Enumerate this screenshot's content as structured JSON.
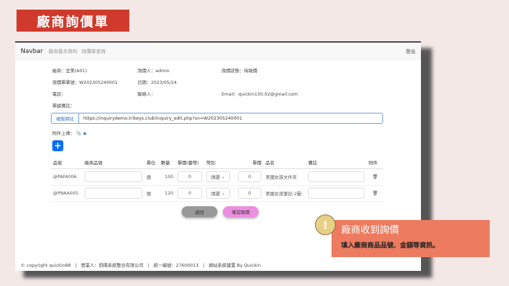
{
  "banner": "廠商詢價單",
  "nav": {
    "brand": "Navbar",
    "links": [
      "廠商基本資料",
      "詢價單查詢"
    ],
    "logout": "登出"
  },
  "info": {
    "vendor": "廠商：呈美(A01)",
    "inquirer": "詢價人：admin",
    "status": "詢價狀態：待報價",
    "number": "詢價單單號：W202305240001",
    "date": "日期：2023/05/24",
    "phone": "電話：",
    "contact": "聯絡人：",
    "email": "Email：quickin130.02@gmail.com",
    "note": "單據備註：",
    "copy_btn": "複製網址",
    "url": "https://inquirydemo.trikeys.club/inquiry_edit.php?sn=W202305240001",
    "attach": "附件上傳："
  },
  "table": {
    "headers": [
      "品號",
      "廠商品號",
      "單位",
      "數量",
      "單價(臺幣)",
      "幣別",
      "單價",
      "品名",
      "備註",
      "附件"
    ],
    "rows": [
      {
        "code": "@PAFA006",
        "unit": "個",
        "qty": "100",
        "twd": "0",
        "currency": "請選",
        "price": "0",
        "name": "美國女孩文件夾"
      },
      {
        "code": "@PNAA005",
        "unit": "個",
        "qty": "120",
        "twd": "0",
        "currency": "請選",
        "price": "0",
        "name": "美國女孩筆記-2圖"
      }
    ]
  },
  "buttons": {
    "back": "返回",
    "confirm": "確認報價"
  },
  "footer": "© copyright quickin88   |   營業人：鈞陽系統整合有限公司   |   統一編號：27600013   |   網站系統建置 By Quickin",
  "callout": {
    "title": "廠商收到詢價",
    "text": "填入廠商商品品號、金額等資訊。"
  }
}
